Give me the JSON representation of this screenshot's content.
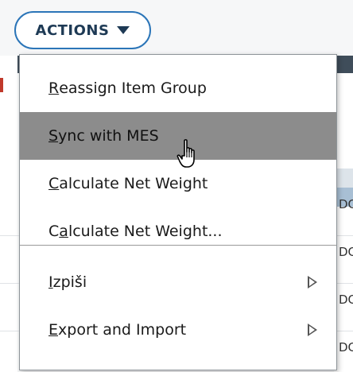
{
  "actions_button": {
    "label": "ACTIONS",
    "icon": "caret-down-icon"
  },
  "menu": {
    "items": [
      {
        "prefix": "",
        "mnemonic": "R",
        "rest": "eassign Item Group",
        "hover": false,
        "submenu": false
      },
      {
        "prefix": "",
        "mnemonic": "S",
        "rest": "ync with MES",
        "hover": true,
        "submenu": false
      },
      {
        "prefix": "",
        "mnemonic": "C",
        "rest": "alculate Net Weight",
        "hover": false,
        "submenu": false
      },
      {
        "prefix": "C",
        "mnemonic": "a",
        "rest": "lculate Net Weight...",
        "hover": false,
        "submenu": false
      },
      {
        "prefix": "",
        "mnemonic": "I",
        "rest": "zpiši",
        "hover": false,
        "submenu": true
      },
      {
        "prefix": "",
        "mnemonic": "E",
        "rest": "xport and Import",
        "hover": false,
        "submenu": true
      }
    ]
  },
  "background": {
    "right_fragment": [
      "DC",
      "DC",
      "DC",
      "DC"
    ]
  },
  "colors": {
    "accent": "#2b75b8",
    "hover": "#8c8c8c",
    "header_strip": "#3f4d5a"
  }
}
